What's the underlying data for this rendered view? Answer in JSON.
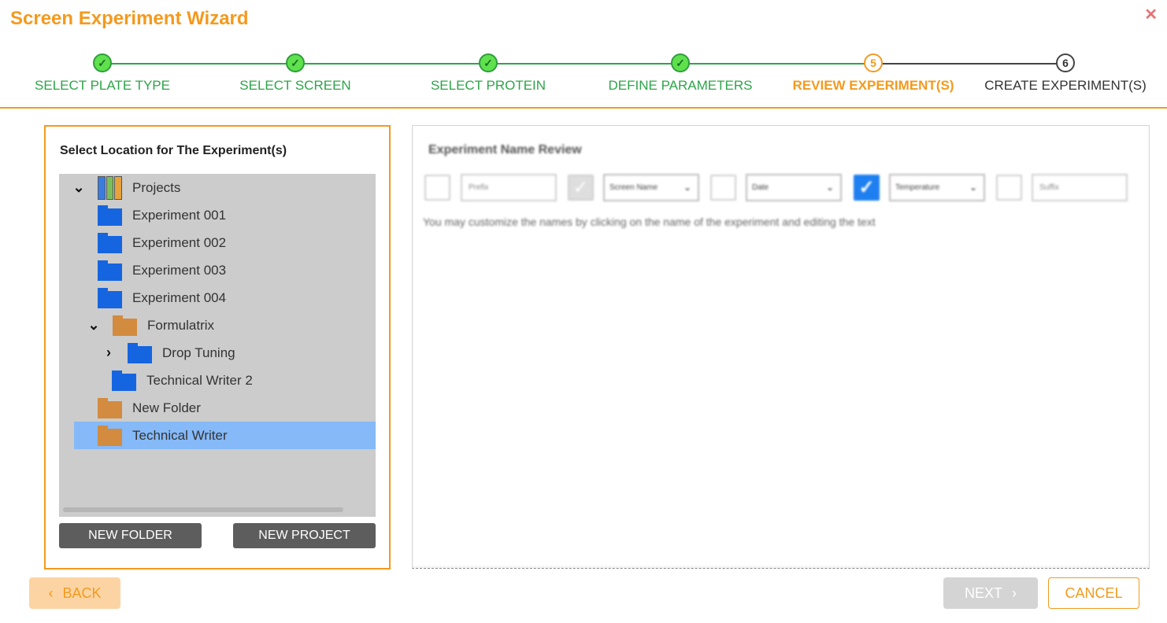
{
  "window": {
    "title": "Screen Experiment Wizard",
    "close_glyph": "✕"
  },
  "stepper": {
    "steps": [
      {
        "label": "SELECT PLATE TYPE",
        "state": "done",
        "marker": "✓"
      },
      {
        "label": "SELECT SCREEN",
        "state": "done",
        "marker": "✓"
      },
      {
        "label": "SELECT PROTEIN",
        "state": "done",
        "marker": "✓"
      },
      {
        "label": "DEFINE PARAMETERS",
        "state": "done",
        "marker": "✓"
      },
      {
        "label": "REVIEW EXPERIMENT(S)",
        "state": "active",
        "marker": "5"
      },
      {
        "label": "CREATE EXPERIMENT(S)",
        "state": "todo",
        "marker": "6"
      }
    ]
  },
  "location": {
    "title": "Select Location for The Experiment(s)",
    "tree": [
      {
        "label": "Projects",
        "icon": "projects-icon",
        "chevron": "expanded"
      },
      {
        "label": "Experiment 001",
        "icon": "folder-blue-icon"
      },
      {
        "label": "Experiment 002",
        "icon": "folder-blue-icon"
      },
      {
        "label": "Experiment 003",
        "icon": "folder-blue-icon"
      },
      {
        "label": "Experiment 004",
        "icon": "folder-blue-icon"
      },
      {
        "label": "Formulatrix",
        "icon": "folder-orange-icon",
        "chevron": "expanded"
      },
      {
        "label": "Drop Tuning",
        "icon": "folder-blue-icon",
        "chevron": "collapsed"
      },
      {
        "label": "Technical Writer 2",
        "icon": "folder-blue-icon"
      },
      {
        "label": "New Folder",
        "icon": "folder-orange-icon"
      },
      {
        "label": "Technical Writer",
        "icon": "folder-orange-icon",
        "selected": true
      }
    ],
    "new_folder_label": "NEW FOLDER",
    "new_project_label": "NEW PROJECT"
  },
  "review": {
    "title": "Experiment Name Review",
    "prefix_placeholder": "Prefix",
    "screen_name_option": "Screen Name",
    "date_option": "Date",
    "temperature_option": "Temperature",
    "suffix_placeholder": "Suffix",
    "hint": "You may customize the names by clicking on the name of the experiment and editing the text"
  },
  "footer": {
    "back_label": "BACK",
    "next_label": "NEXT",
    "cancel_label": "CANCEL"
  },
  "colors": {
    "accent": "#f39a1e",
    "done": "#2ea44a",
    "selected_row": "#85b9f8"
  }
}
